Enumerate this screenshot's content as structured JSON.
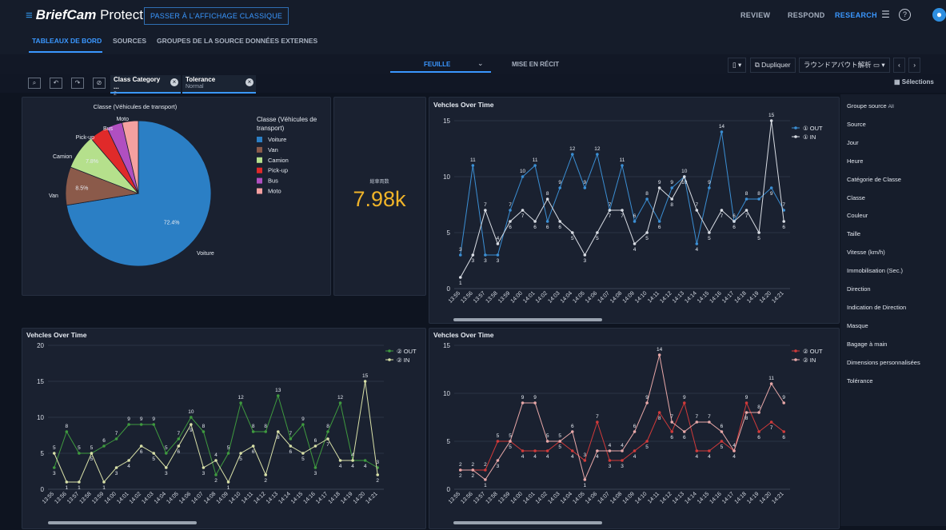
{
  "app": {
    "brand": "BriefCam",
    "product": "Protect",
    "classic_button": "PASSER À L'AFFICHAGE CLASSIQUE"
  },
  "top_nav": {
    "review": "REVIEW",
    "respond": "RESPOND",
    "research": "RESEARCH"
  },
  "tabs": [
    "TABLEAUX DE BORD",
    "SOURCES",
    "GROUPES DE LA SOURCE",
    "DONNÉES EXTERNES"
  ],
  "sheet": {
    "feuille": "FEUILLE",
    "recit": "MISE EN RÉCIT"
  },
  "toolbar": {
    "duplicate": "Dupliquer",
    "name": "ラウンドアバウト解析"
  },
  "filters": [
    {
      "title": "Class Category ...",
      "sub": "2"
    },
    {
      "title": "Tolerance",
      "sub": "Normal"
    }
  ],
  "selections_label": "Sélections",
  "side_panel": {
    "items": [
      "Groupe source",
      "Source",
      "Jour",
      "Heure",
      "Catégorie de Classe",
      "Classe",
      "Couleur",
      "Taille",
      "Vitesse (km/h)",
      "Immobilisation (Sec.)",
      "Direction",
      "Indication de Direction",
      "Masque",
      "Bagage à main",
      "Dimensions personnalisées",
      "Tolérance"
    ],
    "group_value": "All"
  },
  "kpi": {
    "label": "総車両数",
    "value": "7.98k"
  },
  "colors": {
    "accent": "#3a97ff",
    "kpi": "#f0b429"
  },
  "chart_data": [
    {
      "type": "pie",
      "title": "Classe (Véhicules de transport)",
      "legend_title": "Classe (Véhicules de transport)",
      "slices": [
        {
          "label": "Voiture",
          "value": 72.4,
          "pct_label": "72.4%",
          "color": "#2b7fc5"
        },
        {
          "label": "Van",
          "value": 8.5,
          "pct_label": "8.5%",
          "color": "#8b5a4a"
        },
        {
          "label": "Camion",
          "value": 7.8,
          "pct_label": "7.8%",
          "color": "#b5e08c"
        },
        {
          "label": "Pick-up",
          "value": 4.2,
          "pct_label": "",
          "color": "#e02a2a"
        },
        {
          "label": "Bus",
          "value": 3.5,
          "pct_label": "",
          "color": "#b04fc0"
        },
        {
          "label": "Moto",
          "value": 3.6,
          "pct_label": "",
          "color": "#f5a0a0"
        }
      ]
    },
    {
      "type": "line",
      "title": "Vehcles Over Time",
      "x": [
        "13:55",
        "13:56",
        "13:57",
        "13:58",
        "13:59",
        "14:00",
        "14:01",
        "14:02",
        "14:03",
        "14:04",
        "14:05",
        "14:06",
        "14:07",
        "14:08",
        "14:09",
        "14:10",
        "14:11",
        "14:12",
        "14:13",
        "14:14",
        "14:15",
        "14:16",
        "14:17",
        "14:18",
        "14:19",
        "14:20",
        "14:21"
      ],
      "ylim": [
        0,
        15
      ],
      "yticks": [
        0,
        5,
        10,
        15
      ],
      "series": [
        {
          "name": "① OUT",
          "color": "#3b8fd4",
          "values": [
            3,
            11,
            3,
            3,
            7,
            10,
            11,
            6,
            9,
            12,
            9,
            12,
            7,
            11,
            6,
            8,
            6,
            9,
            10,
            4,
            9,
            14,
            6,
            8,
            8,
            9,
            7
          ]
        },
        {
          "name": "① IN",
          "color": "#d9dde4",
          "values": [
            1,
            3,
            7,
            4,
            6,
            7,
            6,
            8,
            6,
            5,
            3,
            5,
            7,
            7,
            4,
            5,
            9,
            8,
            10,
            7,
            5,
            7,
            6,
            7,
            5,
            15,
            6
          ]
        }
      ]
    },
    {
      "type": "line",
      "title": "Vehcles Over Time",
      "x": [
        "13:55",
        "13:56",
        "13:57",
        "13:58",
        "13:59",
        "14:00",
        "14:01",
        "14:02",
        "14:03",
        "14:04",
        "14:05",
        "14:06",
        "14:07",
        "14:08",
        "14:09",
        "14:10",
        "14:11",
        "14:12",
        "14:13",
        "14:14",
        "14:15",
        "14:16",
        "14:17",
        "14:18",
        "14:19",
        "14:20",
        "14:21"
      ],
      "ylim": [
        0,
        20
      ],
      "yticks": [
        0,
        5,
        10,
        15,
        20
      ],
      "series": [
        {
          "name": "② OUT",
          "color": "#3f9a3f",
          "values": [
            3,
            8,
            5,
            5,
            6,
            7,
            9,
            9,
            9,
            5,
            7,
            10,
            8,
            2,
            5,
            12,
            8,
            8,
            13,
            7,
            9,
            3,
            8,
            12,
            4,
            4,
            3
          ]
        },
        {
          "name": "② IN",
          "color": "#d8e0a8",
          "values": [
            5,
            1,
            1,
            5,
            1,
            3,
            4,
            6,
            5,
            3,
            6,
            9,
            3,
            4,
            1,
            5,
            6,
            2,
            8,
            6,
            5,
            6,
            7,
            4,
            4,
            15,
            2
          ]
        }
      ]
    },
    {
      "type": "line",
      "title": "Vehcles Over Time",
      "x": [
        "13:55",
        "13:56",
        "13:57",
        "13:58",
        "13:59",
        "14:00",
        "14:01",
        "14:02",
        "14:03",
        "14:04",
        "14:05",
        "14:06",
        "14:07",
        "14:08",
        "14:09",
        "14:10",
        "14:11",
        "14:12",
        "14:13",
        "14:14",
        "14:15",
        "14:16",
        "14:17",
        "14:18",
        "14:19",
        "14:20",
        "14:21"
      ],
      "ylim": [
        0,
        15
      ],
      "yticks": [
        0,
        5,
        10,
        15
      ],
      "series": [
        {
          "name": "② OUT",
          "color": "#d13a3a",
          "values": [
            2,
            2,
            2,
            5,
            5,
            4,
            4,
            4,
            5,
            4,
            3,
            7,
            3,
            3,
            4,
            5,
            8,
            6,
            9,
            4,
            4,
            5,
            4,
            9,
            6,
            7,
            6
          ]
        },
        {
          "name": "② IN",
          "color": "#e8a8a8",
          "values": [
            2,
            2,
            1,
            3,
            5,
            9,
            9,
            5,
            5,
            6,
            1,
            4,
            4,
            4,
            6,
            9,
            14,
            7,
            6,
            7,
            7,
            6,
            4,
            8,
            8,
            11,
            9
          ]
        }
      ]
    }
  ]
}
